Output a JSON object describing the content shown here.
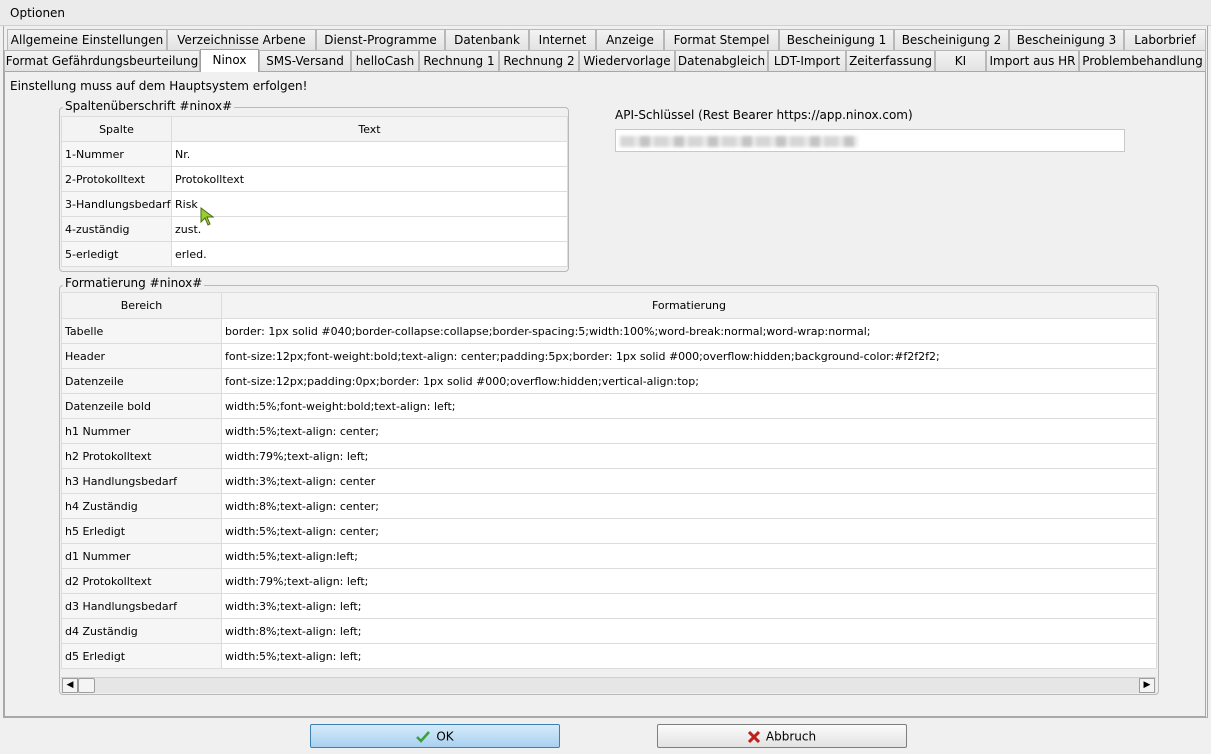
{
  "window": {
    "title": "Optionen"
  },
  "tabs_row1": [
    "Allgemeine Einstellungen",
    "Verzeichnisse Arbene",
    "Dienst-Programme",
    "Datenbank",
    "Internet",
    "Anzeige",
    "Format Stempel",
    "Bescheinigung 1",
    "Bescheinigung 2",
    "Bescheinigung 3",
    "Laborbrief"
  ],
  "tabs_row2": [
    "Format Gefährdungsbeurteilung",
    "Ninox",
    "SMS-Versand",
    "helloCash",
    "Rechnung 1",
    "Rechnung 2",
    "Wiedervorlage",
    "Datenabgleich",
    "LDT-Import",
    "Zeiterfassung",
    "KI",
    "Import aus HR",
    "Problembehandlung"
  ],
  "active_tab": "Ninox",
  "notice": "Einstellung muss auf dem Hauptsystem erfolgen!",
  "columns_group": {
    "title": "Spaltenüberschrift  #ninox#",
    "headers": [
      "Spalte",
      "Text"
    ],
    "rows": [
      [
        "1-Nummer",
        "Nr."
      ],
      [
        "2-Protokolltext",
        "Protokolltext"
      ],
      [
        "3-Handlungsbedarf",
        "Risk"
      ],
      [
        "4-zuständig",
        "zust."
      ],
      [
        "5-erledigt",
        "erled."
      ]
    ]
  },
  "api": {
    "label": "API-Schlüssel (Rest Bearer https://app.ninox.com)"
  },
  "format_group": {
    "title": "Formatierung #ninox#",
    "headers": [
      "Bereich",
      "Formatierung"
    ],
    "rows": [
      [
        "Tabelle",
        "border: 1px solid #040;border-collapse:collapse;border-spacing:5;width:100%;word-break:normal;word-wrap:normal;"
      ],
      [
        "Header",
        "font-size:12px;font-weight:bold;text-align: center;padding:5px;border: 1px solid #000;overflow:hidden;background-color:#f2f2f2;"
      ],
      [
        "Datenzeile",
        "font-size:12px;padding:0px;border: 1px solid #000;overflow:hidden;vertical-align:top;"
      ],
      [
        "Datenzeile bold",
        "width:5%;font-weight:bold;text-align: left;"
      ],
      [
        "h1 Nummer",
        "width:5%;text-align: center;"
      ],
      [
        "h2 Protokolltext",
        "width:79%;text-align: left;"
      ],
      [
        "h3 Handlungsbedarf",
        "width:3%;text-align: center"
      ],
      [
        "h4 Zuständig",
        "width:8%;text-align: center;"
      ],
      [
        "h5 Erledigt",
        "width:5%;text-align: center;"
      ],
      [
        "d1 Nummer",
        "width:5%;text-align:left;"
      ],
      [
        "d2 Protokolltext",
        "width:79%;text-align: left;"
      ],
      [
        "d3 Handlungsbedarf",
        "width:3%;text-align: left;"
      ],
      [
        "d4 Zuständig",
        "width:8%;text-align: left;"
      ],
      [
        "d5 Erledigt",
        "width:5%;text-align: left;"
      ]
    ]
  },
  "buttons": {
    "ok": "OK",
    "cancel": "Abbruch"
  },
  "colors": {
    "ok_check": "#3aa13a",
    "cancel_x": "#c0201a",
    "cursor": "#9acd32"
  }
}
